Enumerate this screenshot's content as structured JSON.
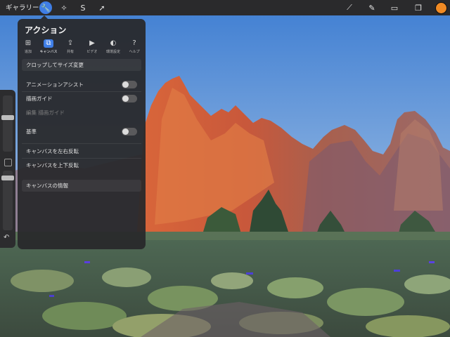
{
  "toolbar": {
    "gallery_label": "ギャラリー",
    "left_tools": [
      {
        "icon": "wrench-icon",
        "glyph": "🔧",
        "active": true
      },
      {
        "icon": "magic-wand-icon",
        "glyph": "✧",
        "active": false
      },
      {
        "icon": "selection-icon",
        "glyph": "S",
        "active": false
      },
      {
        "icon": "transform-arrow-icon",
        "glyph": "➚",
        "active": false
      }
    ],
    "right_tools": [
      {
        "icon": "brush-icon",
        "glyph": "⟋"
      },
      {
        "icon": "smudge-icon",
        "glyph": "✎"
      },
      {
        "icon": "eraser-icon",
        "glyph": "▭"
      },
      {
        "icon": "layers-icon",
        "glyph": "❐"
      }
    ],
    "active_color": "#f08a24"
  },
  "panel": {
    "title": "アクション",
    "tabs": [
      {
        "label": "追加",
        "icon": "add-icon",
        "glyph": "⊞",
        "selected": false
      },
      {
        "label": "キャンバス",
        "icon": "canvas-icon",
        "glyph": "⧉",
        "selected": true
      },
      {
        "label": "共有",
        "icon": "share-icon",
        "glyph": "⇪",
        "selected": false
      },
      {
        "label": "ビデオ",
        "icon": "video-play-icon",
        "glyph": "▶",
        "selected": false
      },
      {
        "label": "環境設定",
        "icon": "preferences-toggle-icon",
        "glyph": "◐",
        "selected": false
      },
      {
        "label": "ヘルプ",
        "icon": "help-icon",
        "glyph": "?",
        "selected": false
      }
    ],
    "items": {
      "crop": "クロップしてサイズ変更",
      "animation_assist": "アニメーションアシスト",
      "drawing_guide": "描画ガイド",
      "edit_drawing_guide": "編集 描画ガイド",
      "reference": "基準",
      "flip_horizontal": "キャンバスを左右反転",
      "flip_vertical": "キャンバスを上下反転",
      "canvas_info": "キャンバスの情報"
    }
  },
  "sidebar": {
    "undo_icon": "undo-icon",
    "undo_glyph": "↶"
  }
}
